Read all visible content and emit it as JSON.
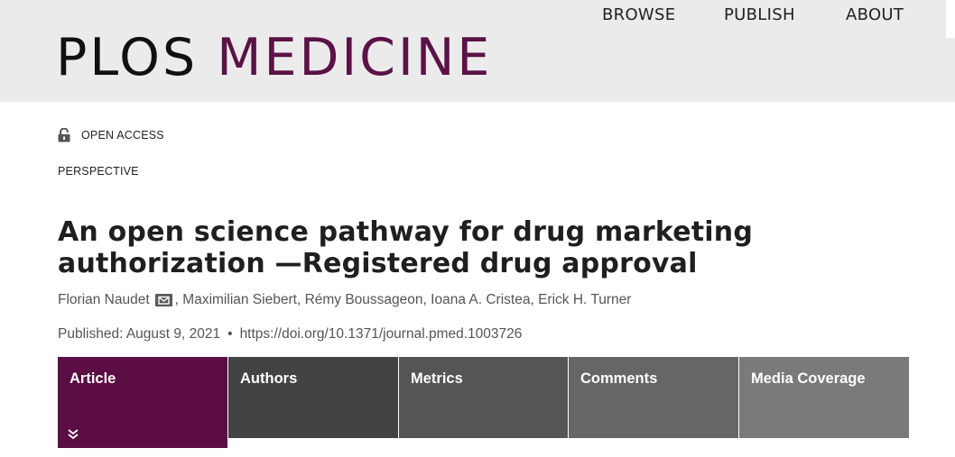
{
  "nav": {
    "items": [
      "BROWSE",
      "PUBLISH",
      "ABOUT"
    ]
  },
  "logo": {
    "part1": "PLOS",
    "part2": "MEDICINE",
    "color_plos": "#111111",
    "color_medicine": "#5b1247"
  },
  "article": {
    "access_label": "OPEN ACCESS",
    "type": "PERSPECTIVE",
    "title": "An open science pathway for drug marketing authorization —Registered drug approval",
    "authors": [
      "Florian Naudet",
      "Maximilian Siebert",
      "Rémy Boussageon",
      "Ioana A. Cristea",
      "Erick H. Turner"
    ],
    "published": "Published: August 9, 2021",
    "separator": "•",
    "doi": "https://doi.org/10.1371/journal.pmed.1003726"
  },
  "tabs": [
    {
      "label": "Article",
      "active": true,
      "color": "#5b0d44"
    },
    {
      "label": "Authors",
      "active": false,
      "color": "#434343"
    },
    {
      "label": "Metrics",
      "active": false,
      "color": "#555555"
    },
    {
      "label": "Comments",
      "active": false,
      "color": "#666666"
    },
    {
      "label": "Media Coverage",
      "active": false,
      "color": "#7a7a7a"
    }
  ],
  "icons": {
    "lock": "unlocked-padlock-icon",
    "mail": "envelope-icon",
    "chevron": "double-chevron-down-icon"
  }
}
